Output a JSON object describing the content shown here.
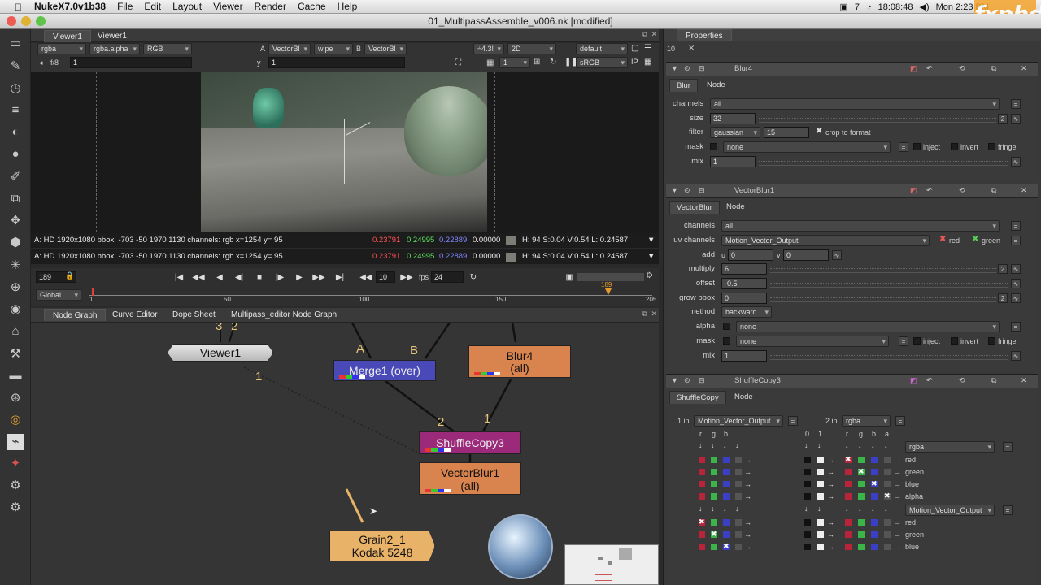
{
  "menubar": {
    "app": "NukeX7.0v1b38",
    "items": [
      "File",
      "Edit",
      "Layout",
      "Viewer",
      "Render",
      "Cache",
      "Help"
    ],
    "clock": "18:08:48",
    "date": "Mon 2:23 PM",
    "status_num": "7"
  },
  "watermark": "fxphd",
  "window": {
    "title": "01_MultipassAssemble_v006.nk [modified]"
  },
  "viewer": {
    "tabs": [
      "Viewer1",
      "Viewer1"
    ],
    "row1": {
      "channels": "rgba",
      "alpha": "rgba.alpha",
      "display": "RGB",
      "a_label": "A",
      "a_input": "VectorBl",
      "wipe": "wipe",
      "b_label": "B",
      "b_input": "VectorBl",
      "gain": "÷4.3!",
      "view": "2D",
      "lut": "default"
    },
    "row2": {
      "fstop": "f/8",
      "frame": "1",
      "y_label": "y",
      "y_value": "1",
      "proxy": "1",
      "colorspace": "sRGB"
    },
    "info_a": {
      "text": "A: HD 1920x1080 bbox: -703 -50 1970 1130 channels: rgb  x=1254 y=  95",
      "r": "0.23791",
      "g": "0.24995",
      "b": "0.22889",
      "a": "0.00000",
      "hsv": "H: 94 S:0.04 V:0.54  L: 0.24587"
    },
    "info_b": {
      "text": "A: HD 1920x1080 bbox: -703 -50 1970 1130 channels: rgb  x=1254 y=  95",
      "r": "0.23791",
      "g": "0.24995",
      "b": "0.22889",
      "a": "0.00000",
      "hsv": "H: 94 S:0.04 V:0.54  L: 0.24587"
    },
    "timeline": {
      "frame": "189",
      "increment": "10",
      "fps_label": "fps",
      "fps": "24",
      "scope": "Global",
      "ticks": [
        "1",
        "50",
        "100",
        "150",
        "205"
      ],
      "current_marker": "189"
    }
  },
  "graph_tabs": [
    "Node Graph",
    "Curve Editor",
    "Dope Sheet",
    "Multipass_editor Node Graph"
  ],
  "nodes": {
    "viewer1": "Viewer1",
    "merge1": "Merge1 (over)",
    "blur4_title": "Blur4",
    "blur4_sub": "(all)",
    "shuffle": "ShuffleCopy3",
    "vblur_title": "VectorBlur1",
    "vblur_sub": "(all)",
    "grain_title": "Grain2_1",
    "grain_sub": "Kodak 5248",
    "edge_labels": {
      "viewer_top_a": "3",
      "viewer_top_b": "2",
      "viewer_in": "1",
      "merge_a": "A",
      "merge_b": "B",
      "shuffle_2": "2",
      "shuffle_1": "1"
    }
  },
  "properties": {
    "title": "Properties",
    "max_panels": "10",
    "blur": {
      "name": "Blur4",
      "tabs": [
        "Blur",
        "Node"
      ],
      "channels_label": "channels",
      "channels": "all",
      "size_label": "size",
      "size": "32",
      "filter_label": "filter",
      "filter": "gaussian",
      "quality": "15",
      "crop": "crop to format",
      "mask_label": "mask",
      "mask": "none",
      "inject": "inject",
      "invert": "invert",
      "fringe": "fringe",
      "mix_label": "mix",
      "mix": "1"
    },
    "vectorblur": {
      "name": "VectorBlur1",
      "tabs": [
        "VectorBlur",
        "Node"
      ],
      "channels_label": "channels",
      "channels": "all",
      "uv_label": "uv channels",
      "uv": "Motion_Vector_Output",
      "red": "red",
      "green": "green",
      "add_label": "add",
      "u_label": "u",
      "u": "0",
      "v_label": "v",
      "v": "0",
      "multiply_label": "multiply",
      "multiply": "6",
      "offset_label": "offset",
      "offset": "-0.5",
      "growbbox_label": "grow bbox",
      "growbbox": "0",
      "method_label": "method",
      "method": "backward",
      "alpha_label": "alpha",
      "alpha": "none",
      "mask_label": "mask",
      "mask": "none",
      "inject": "inject",
      "invert": "invert",
      "fringe": "fringe",
      "mix_label": "mix",
      "mix": "1"
    },
    "shuffle": {
      "name": "ShuffleCopy3",
      "tabs": [
        "ShuffleCopy",
        "Node"
      ],
      "in1_label": "1 in",
      "in1": "Motion_Vector_Output",
      "in2_label": "2 in",
      "in2": "rgba",
      "col_labels_left": [
        "r",
        "g",
        "b"
      ],
      "col_labels_right": [
        "0",
        "1",
        "r",
        "g",
        "b",
        "a"
      ],
      "out1": "rgba",
      "out1_channels": [
        "red",
        "green",
        "blue",
        "alpha"
      ],
      "out2": "Motion_Vector_Output",
      "out2_channels": [
        "red",
        "green",
        "blue"
      ]
    }
  },
  "colors": {
    "blur_node": "#d9844e",
    "merge_node": "#4a49b8",
    "shuffle_node": "#9b2a7a",
    "grain_node": "#e9b269",
    "viewer_node": "#cfcfcf",
    "accent_marker": "#e39a2f"
  }
}
